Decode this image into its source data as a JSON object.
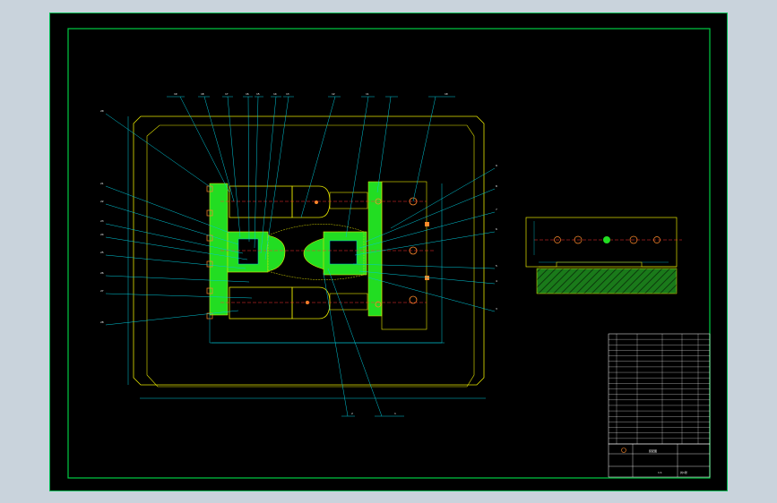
{
  "drawing": {
    "colors": {
      "background": "#000000",
      "viewer_frame": "#c9d3dc",
      "border_green": "#00cc44",
      "outline_yellow": "#e6e600",
      "fill_green": "#22dd22",
      "leader_cyan": "#00c8d8",
      "centerline_red": "#ff3030",
      "accent_orange": "#ff8a2a"
    },
    "balloon_labels_top": [
      "19",
      "18",
      "17",
      "16",
      "15",
      "14",
      "13",
      "12",
      "11",
      "10"
    ],
    "balloon_labels_right": [
      "9",
      "8",
      "7",
      "6",
      "5",
      "4",
      "3"
    ],
    "balloon_labels_left": [
      "20",
      "21",
      "22",
      "23",
      "24",
      "25",
      "26",
      "27",
      "28"
    ],
    "balloon_labels_bottom": [
      "2",
      "1"
    ],
    "title_block": {
      "drawing_title": "装配图",
      "scale": "1:1",
      "sheet": "共1张"
    }
  }
}
